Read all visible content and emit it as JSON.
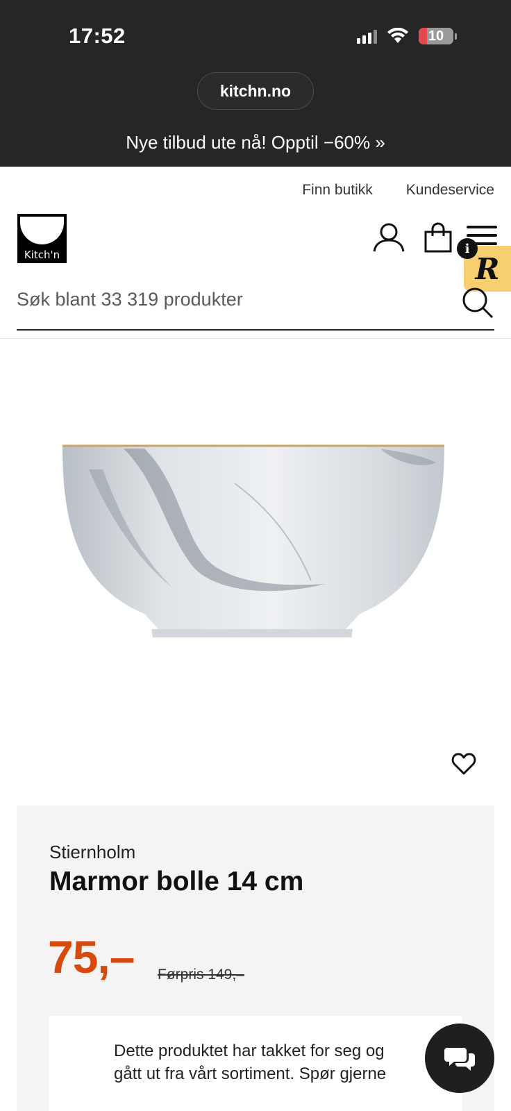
{
  "status_bar": {
    "time": "17:52",
    "battery": "10"
  },
  "browser": {
    "url": "kitchn.no"
  },
  "promo": {
    "text": "Nye tilbud ute nå! Opptil −60% »"
  },
  "top_links": {
    "find_store": "Finn butikk",
    "customer_service": "Kundeservice"
  },
  "logo": {
    "text": "Kitch'n"
  },
  "search": {
    "placeholder": "Søk blant 33 319 produkter"
  },
  "badge": {
    "r_letter": "R",
    "info_letter": "i"
  },
  "product": {
    "brand": "Stiernholm",
    "title": "Marmor bolle 14 cm",
    "price": "75,–",
    "old_price": "Førpris 149,–",
    "notice": "Dette produktet har takket for seg og gått ut fra vårt sortiment. Spør gjerne"
  },
  "colors": {
    "accent_price": "#d64a10",
    "header_bg": "#262626",
    "panel_bg": "#f5f3f3",
    "badge_yellow": "#f8cf6e"
  }
}
